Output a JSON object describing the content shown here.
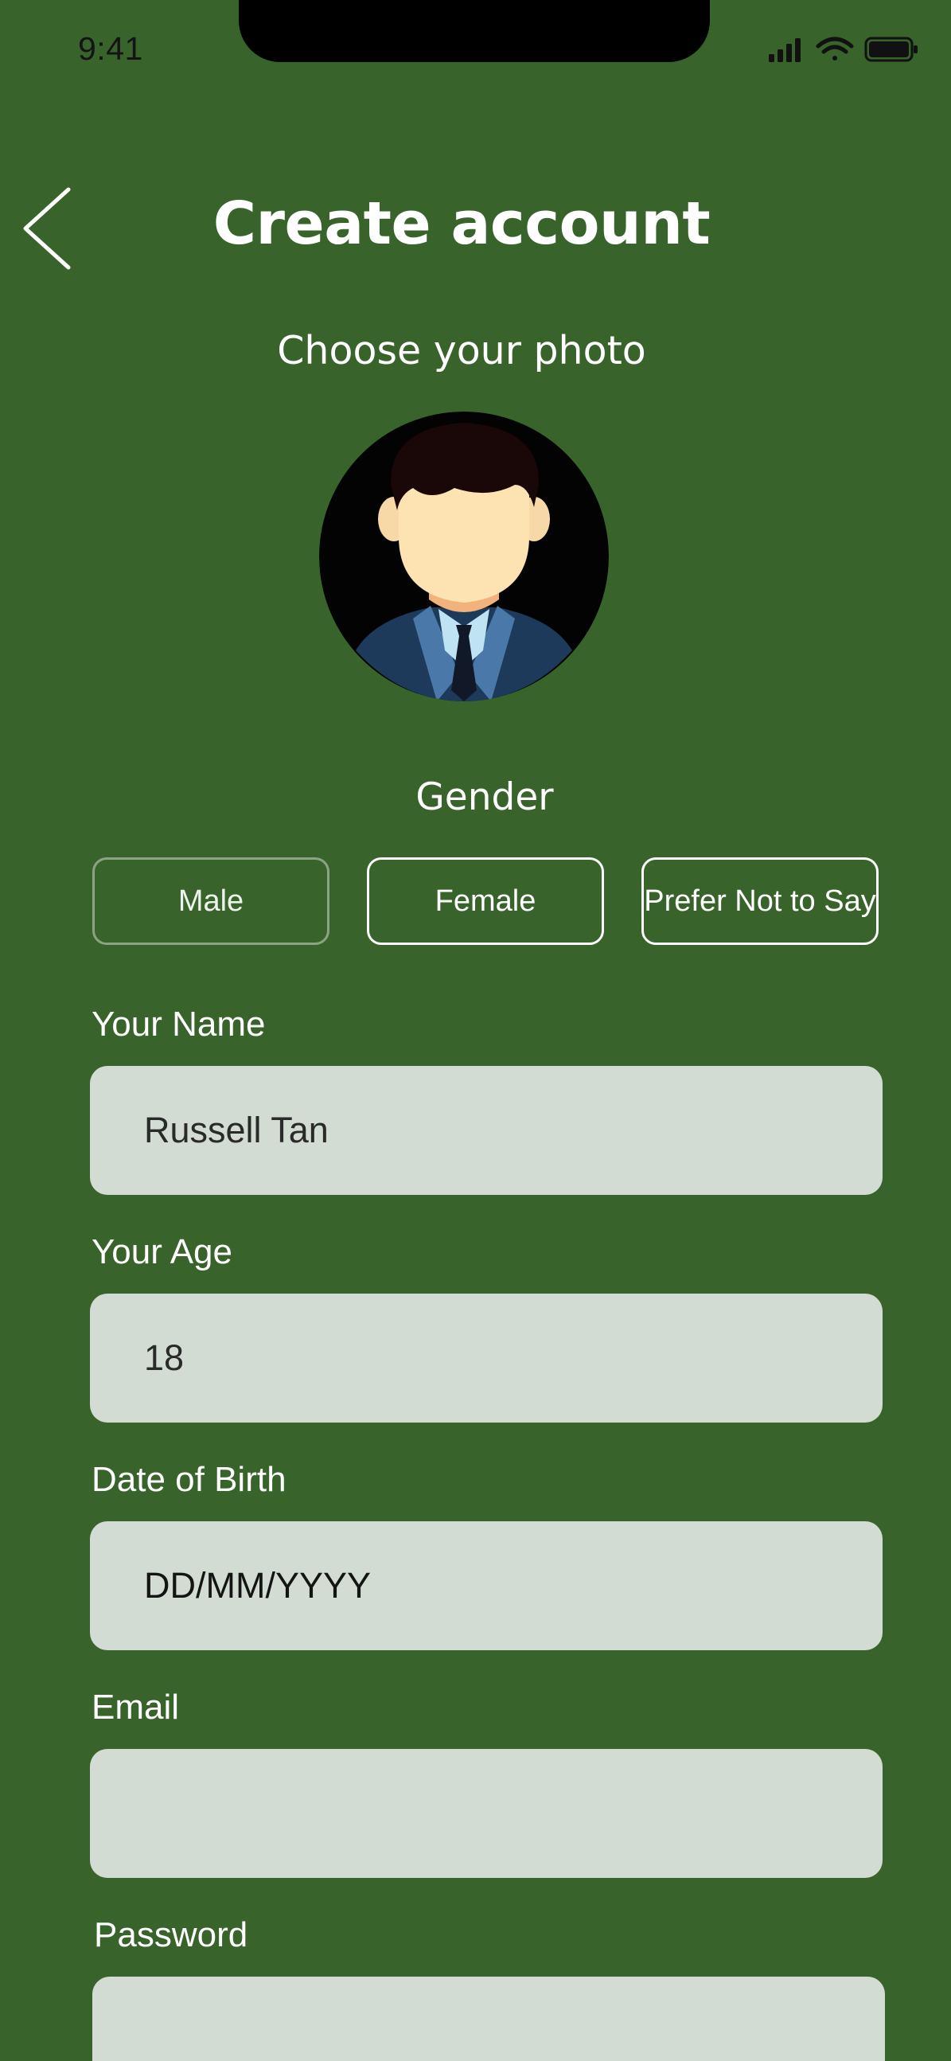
{
  "status_bar": {
    "time": "9:41"
  },
  "header": {
    "title": "Create account"
  },
  "photo": {
    "prompt": "Choose your photo"
  },
  "gender": {
    "label": "Gender",
    "options": [
      "Male",
      "Female",
      "Prefer Not to Say"
    ]
  },
  "form": {
    "name": {
      "label": "Your Name",
      "value": "Russell Tan"
    },
    "age": {
      "label": "Your Age",
      "value": "18"
    },
    "dob": {
      "label": "Date of Birth",
      "placeholder": "DD/MM/YYYY"
    },
    "email": {
      "label": "Email",
      "value": ""
    },
    "password": {
      "label": "Password",
      "value": ""
    }
  },
  "colors": {
    "background": "#38632b",
    "field_fill": "#d3dcd2",
    "text": "#ffffff"
  }
}
